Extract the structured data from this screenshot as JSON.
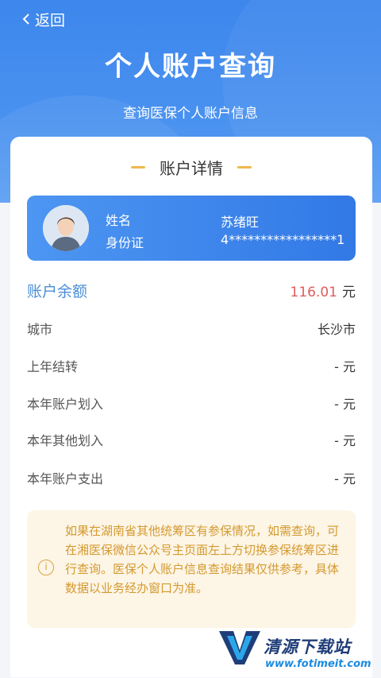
{
  "header": {
    "back_label": "返回",
    "title": "个人账户查询",
    "subtitle": "查询医保个人账户信息"
  },
  "card": {
    "title": "账户详情"
  },
  "user": {
    "name_label": "姓名",
    "id_label": "身份证",
    "name_value": "苏绪旺",
    "id_value": "4*****************1"
  },
  "balance": {
    "label": "账户余额",
    "amount": "116.01",
    "unit": "元"
  },
  "rows": [
    {
      "label": "城市",
      "value": "长沙市"
    },
    {
      "label": "上年结转",
      "value": "- 元"
    },
    {
      "label": "本年账户划入",
      "value": "- 元"
    },
    {
      "label": "本年其他划入",
      "value": "- 元"
    },
    {
      "label": "本年账户支出",
      "value": "- 元"
    }
  ],
  "notice": {
    "icon": "info-icon",
    "text": "如果在湖南省其他统筹区有参保情况，如需查询，可在湘医保微信公众号主页面左上方切换参保统筹区进行查询。医保个人账户信息查询结果仅供参考，具体数据以业务经办窗口为准。"
  },
  "watermark": {
    "name": "清源下载站",
    "url": "www.fotimeit.com"
  },
  "colors": {
    "primary": "#3d86ec",
    "accent_gold": "#f2b84b",
    "amount_red": "#e05c5c",
    "notice_text": "#d49a2f"
  }
}
